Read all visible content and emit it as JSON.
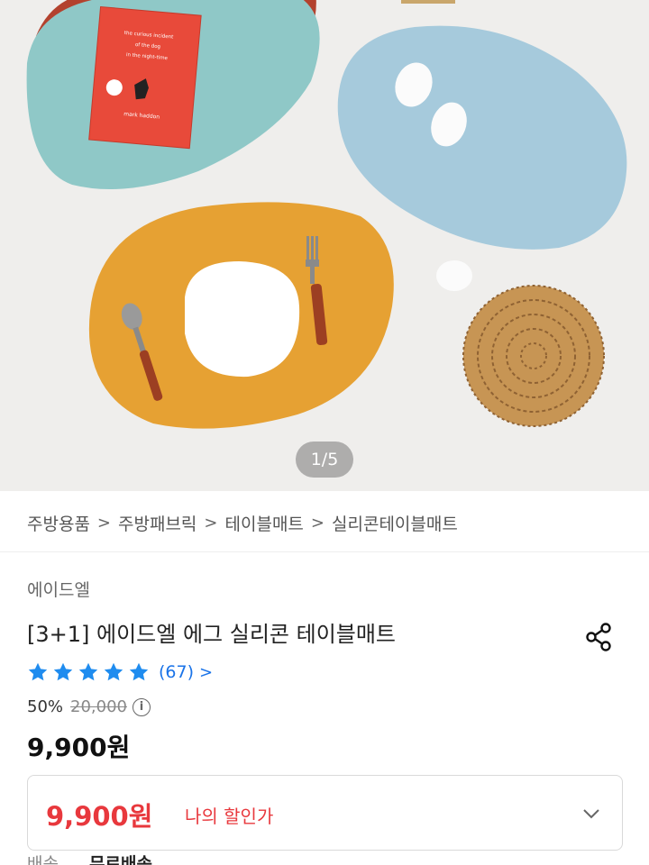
{
  "gallery": {
    "page_indicator": "1/5",
    "book": {
      "line1": "the curious incident",
      "line2": "of the dog",
      "line3": "in the night-time",
      "author": "mark haddon"
    }
  },
  "breadcrumb": [
    "주방용품",
    "주방패브릭",
    "테이블매트",
    "실리콘테이블매트"
  ],
  "product": {
    "brand": "에이드엘",
    "title": "[3+1] 에이드엘 에그 실리콘 테이블매트",
    "rating": 5,
    "review_count": "(67)",
    "discount": "50%",
    "original_price": "20,000",
    "sale_price": "9,900원"
  },
  "my_price": {
    "value": "9,900원",
    "label": "나의 할인가"
  },
  "shipping": {
    "label": "배송",
    "value": "무료배송"
  },
  "colors": {
    "accent_red": "#e8383d",
    "link_blue": "#1a73e8",
    "star_blue": "#1f8cef"
  },
  "icons": [
    "share-icon",
    "star-icon",
    "chevron-right-icon",
    "info-icon",
    "chevron-down-icon"
  ]
}
